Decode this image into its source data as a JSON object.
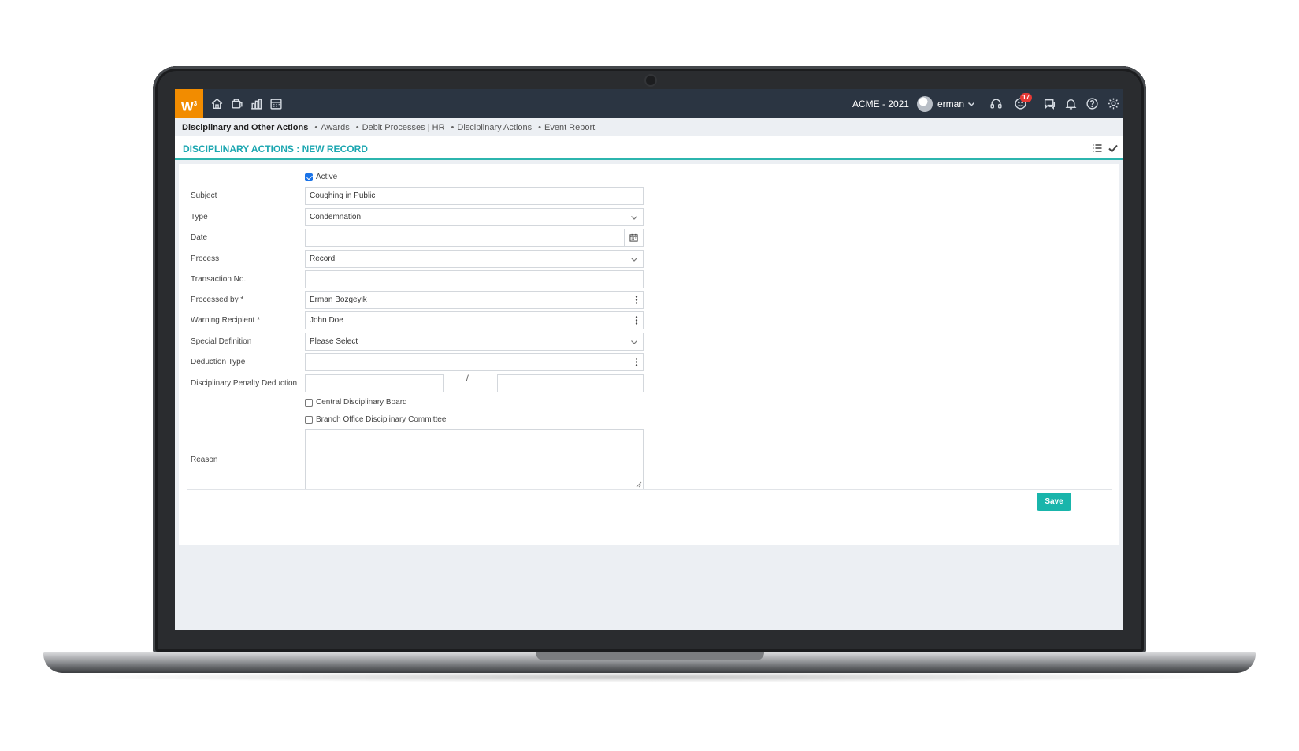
{
  "app": {
    "logo": "W",
    "logo_sup": "3"
  },
  "topbar": {
    "company": "ACME - 2021",
    "username": "erman",
    "notification_count": "17"
  },
  "breadcrumb": [
    "Disciplinary and Other Actions",
    "Awards",
    "Debit Processes | HR",
    "Disciplinary Actions",
    "Event Report"
  ],
  "page": {
    "title": "DISCIPLINARY ACTIONS : NEW RECORD"
  },
  "form": {
    "active_label": "Active",
    "active_checked": true,
    "subject": {
      "label": "Subject",
      "value": "Coughing in Public"
    },
    "type": {
      "label": "Type",
      "value": "Condemnation"
    },
    "date": {
      "label": "Date",
      "value": ""
    },
    "process": {
      "label": "Process",
      "value": "Record"
    },
    "transaction_no": {
      "label": "Transaction No.",
      "value": ""
    },
    "processed_by": {
      "label": "Processed by *",
      "value": "Erman Bozgeyik"
    },
    "warning_recipient": {
      "label": "Warning Recipient *",
      "value": "John Doe"
    },
    "special_definition": {
      "label": "Special Definition",
      "value": "Please Select"
    },
    "deduction_type": {
      "label": "Deduction Type",
      "value": ""
    },
    "penalty_deduction": {
      "label": "Disciplinary Penalty Deduction",
      "separator": "/",
      "value_a": "",
      "value_b": ""
    },
    "central_board_label": "Central Disciplinary Board",
    "branch_committee_label": "Branch Office Disciplinary Committee",
    "reason": {
      "label": "Reason",
      "value": ""
    }
  },
  "actions": {
    "save_label": "Save"
  },
  "colors": {
    "accent": "#19b5ab",
    "title": "#1ba6b0",
    "topbar": "#2b3542",
    "logo": "#f28c00",
    "badge": "#e53935"
  }
}
